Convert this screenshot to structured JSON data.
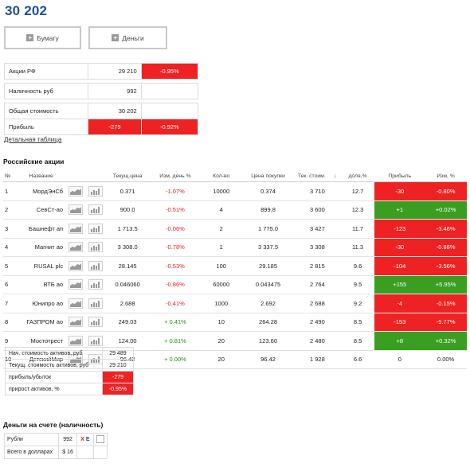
{
  "header": {
    "total": "30 202",
    "currency_glyph": ""
  },
  "tabs": [
    {
      "label": "Бумагу"
    },
    {
      "label": "Деньги"
    }
  ],
  "summary": {
    "rows": [
      {
        "label": "Акции РФ",
        "value": "29 210 ",
        "pct": "-0.95%"
      },
      {
        "label": "Наличность руб",
        "value": "992 ",
        "pct": ""
      },
      {
        "label": "Общая стоимость",
        "value": "30 202 ",
        "pct": ""
      },
      {
        "label": "Прибыль",
        "value": "-279 ",
        "pct": "-0.92%"
      }
    ]
  },
  "detail_link": "Детальная таблица",
  "stocks": {
    "title": "Российские акции",
    "headers": [
      "№",
      "Название",
      "",
      "",
      "Текущ.цена",
      "Изм, день %",
      "Кол-во",
      "Цена покупки",
      "Тек. стоим.",
      "↓",
      "доля,%",
      "Прибыль",
      "Изм, %"
    ],
    "rows": [
      {
        "n": "1",
        "name": "МордЭнСб",
        "price": "0.371",
        "day": "-1.07%",
        "qty": "10000",
        "buy": "0.374",
        "value": "3 710",
        "share": "12.7",
        "profit": "-30",
        "chg": "-0.80%"
      },
      {
        "n": "2",
        "name": "СевСт-ао",
        "price": "900.0",
        "day": "-0.51%",
        "qty": "4",
        "buy": "899.8",
        "value": "3 600",
        "share": "12.3",
        "profit": "+1",
        "chg": "+0.02%"
      },
      {
        "n": "3",
        "name": "Башнефт ап",
        "price": "1 713.5",
        "day": "-0.06%",
        "qty": "2",
        "buy": "1 775.0",
        "value": "3 427",
        "share": "11.7",
        "profit": "-123",
        "chg": "-3.46%"
      },
      {
        "n": "4",
        "name": "Магнит ао",
        "price": "3 308.0",
        "day": "-0.78%",
        "qty": "1",
        "buy": "3 337.5",
        "value": "3 308",
        "share": "11.3",
        "profit": "-30",
        "chg": "-0.88%"
      },
      {
        "n": "5",
        "name": "RUSAL plc",
        "price": "28.145",
        "day": "-0.53%",
        "qty": "100",
        "buy": "29.185",
        "value": "2 815",
        "share": "9.6",
        "profit": "-104",
        "chg": "-3.56%"
      },
      {
        "n": "6",
        "name": "ВТБ ао",
        "price": "0.046060",
        "day": "-0.86%",
        "qty": "60000",
        "buy": "0.043475",
        "value": "2 764",
        "share": "9.5",
        "profit": "+155",
        "chg": "+5.95%"
      },
      {
        "n": "7",
        "name": "Юнипро ао",
        "price": "2.688",
        "day": "-0.41%",
        "qty": "1000",
        "buy": "2.692",
        "value": "2 688",
        "share": "9.2",
        "profit": "-4",
        "chg": "-0.15%"
      },
      {
        "n": "8",
        "name": "ГАЗПРОМ ао",
        "price": "249.03",
        "day": "+ 0.41%",
        "qty": "10",
        "buy": "264.28",
        "value": "2 490",
        "share": "8.5",
        "profit": "-153",
        "chg": "-5.77%"
      },
      {
        "n": "9",
        "name": "Мостотрест",
        "price": "124.00",
        "day": "+ 0.81%",
        "qty": "20",
        "buy": "123.60",
        "value": "2 480",
        "share": "8.5",
        "profit": "+8",
        "chg": "+0.32%"
      },
      {
        "n": "10",
        "name": "ДетскийМир",
        "price": "96.42",
        "day": "+ 0.00%",
        "qty": "20",
        "buy": "96.42",
        "value": "1 928",
        "share": "6.6",
        "profit": "0",
        "chg": "0.00%"
      }
    ]
  },
  "totals": [
    {
      "label": "Нач. стоимость активов, руб",
      "value": "29 489 "
    },
    {
      "label": "Текущ. стоимость активов, руб",
      "value": "29 210 "
    },
    {
      "label": "прибыль/убыток",
      "value": "-279 "
    },
    {
      "label": "прирост активов, %",
      "value": "-0.95%"
    }
  ],
  "cash": {
    "title": "Деньги на счете (наличность)",
    "rows": [
      {
        "label": "Рубли",
        "value": "992 "
      },
      {
        "label": "Всего в долларах",
        "value": "$ 16"
      }
    ],
    "x_label": "X",
    "e_label": "E"
  },
  "colors": {
    "red": "#ee2222",
    "green": "#3a9e21",
    "title_blue": "#1f4e9c"
  }
}
